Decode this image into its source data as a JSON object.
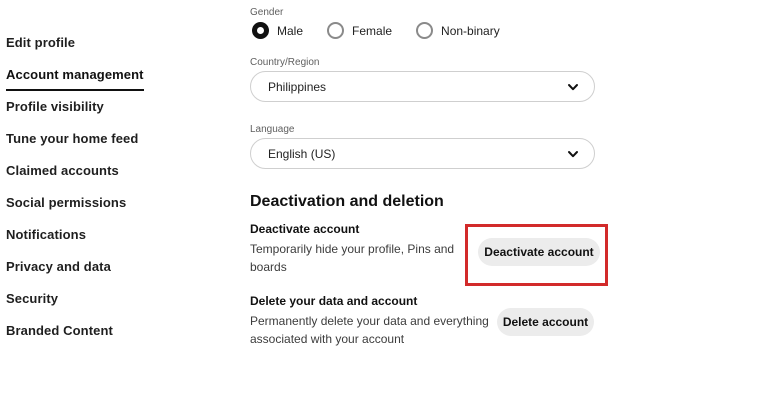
{
  "sidebar": {
    "items": [
      {
        "label": "Edit profile",
        "active": false
      },
      {
        "label": "Account management",
        "active": true
      },
      {
        "label": "Profile visibility",
        "active": false
      },
      {
        "label": "Tune your home feed",
        "active": false
      },
      {
        "label": "Claimed accounts",
        "active": false
      },
      {
        "label": "Social permissions",
        "active": false
      },
      {
        "label": "Notifications",
        "active": false
      },
      {
        "label": "Privacy and data",
        "active": false
      },
      {
        "label": "Security",
        "active": false
      },
      {
        "label": "Branded Content",
        "active": false
      }
    ]
  },
  "form": {
    "gender": {
      "label": "Gender",
      "options": [
        {
          "label": "Male",
          "selected": true
        },
        {
          "label": "Female",
          "selected": false
        },
        {
          "label": "Non-binary",
          "selected": false
        }
      ]
    },
    "country": {
      "label": "Country/Region",
      "value": "Philippines",
      "icon": "chevron-down-icon"
    },
    "language": {
      "label": "Language",
      "value": "English (US)",
      "icon": "chevron-down-icon"
    }
  },
  "deactivation": {
    "heading": "Deactivation and deletion",
    "deactivate": {
      "title": "Deactivate account",
      "description_lines": [
        "Temporarily hide your profile, Pins and",
        "boards"
      ],
      "button_label": "Deactivate account",
      "highlighted": true,
      "highlight_color": "#d22a2a"
    },
    "delete": {
      "title": "Delete your data and account",
      "description_lines": [
        "Permanently delete your data and everything",
        "associated with your account"
      ],
      "button_label": "Delete account"
    }
  },
  "colors": {
    "background": "#ffffff",
    "text": "#111111",
    "muted_label": "#5f5f5f",
    "pill_border": "#cfcfcf",
    "button_bg": "#ececec",
    "highlight": "#d22a2a"
  }
}
